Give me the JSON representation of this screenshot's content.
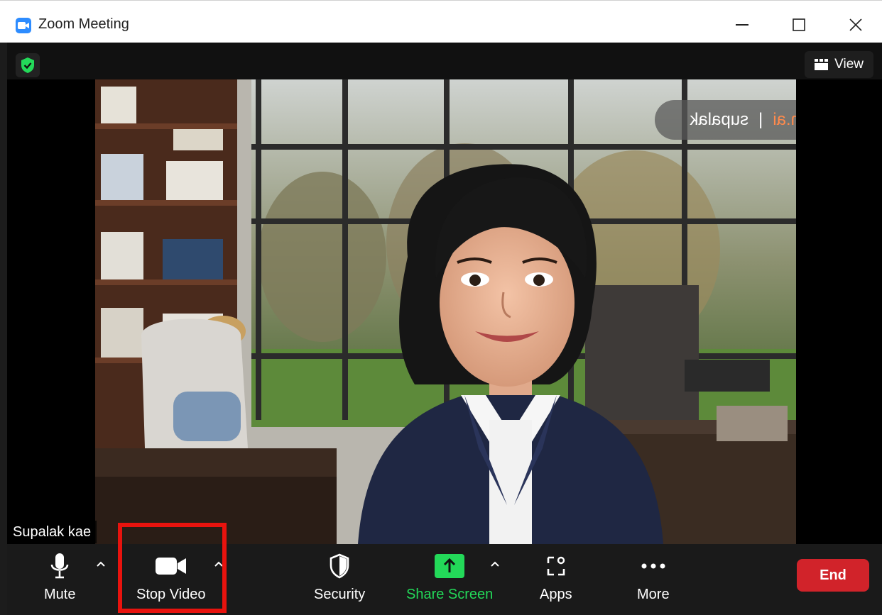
{
  "window": {
    "title": "Zoom Meeting"
  },
  "topbar": {
    "view_label": "View"
  },
  "video": {
    "watermark_brand": "loom.ai",
    "watermark_divider": "|",
    "watermark_user": "supalak",
    "participant_name": "Supalak kae"
  },
  "toolbar": {
    "mute_label": "Mute",
    "stop_video_label": "Stop Video",
    "security_label": "Security",
    "share_screen_label": "Share Screen",
    "apps_label": "Apps",
    "more_label": "More",
    "end_label": "End"
  },
  "colors": {
    "accent_green": "#23d959",
    "end_red": "#d1232a",
    "highlight_red": "#e8130e",
    "zoom_blue": "#2d8cff"
  },
  "icons": [
    "zoom-logo-icon",
    "minimize-icon",
    "maximize-icon",
    "close-icon",
    "encryption-shield-icon",
    "view-grid-icon",
    "microphone-icon",
    "video-camera-icon",
    "security-shield-icon",
    "share-arrow-icon",
    "apps-icon",
    "more-dots-icon",
    "caret-up-icon"
  ]
}
